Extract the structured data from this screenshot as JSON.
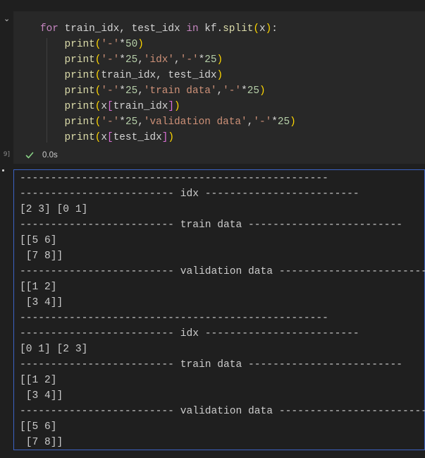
{
  "cell": {
    "code_lines": [
      "for train_idx, test_idx in kf.split(x):",
      "    print('-'*50)",
      "    print('-'*25,'idx','-'*25)",
      "    print(train_idx, test_idx)",
      "    print('-'*25,'train data','-'*25)",
      "    print(x[train_idx])",
      "    print('-'*25,'validation data','-'*25)",
      "    print(x[test_idx])"
    ],
    "execution_count": "9]",
    "status_time": "0.0s",
    "status_icon": "check-icon",
    "status_color": "#89d185"
  },
  "output": {
    "lines": [
      "--------------------------------------------------",
      "------------------------- idx -------------------------",
      "[2 3] [0 1]",
      "------------------------- train data -------------------------",
      "[[5 6]",
      " [7 8]]",
      "------------------------- validation data -------------------------",
      "[[1 2]",
      " [3 4]]",
      "--------------------------------------------------",
      "------------------------- idx -------------------------",
      "[0 1] [2 3]",
      "------------------------- train data -------------------------",
      "[[1 2]",
      " [3 4]]",
      "------------------------- validation data -------------------------",
      "[[5 6]",
      " [7 8]]"
    ]
  },
  "colors": {
    "background": "#1f1f1f",
    "cell_background": "#282828",
    "focus_border": "#3c63c4"
  }
}
